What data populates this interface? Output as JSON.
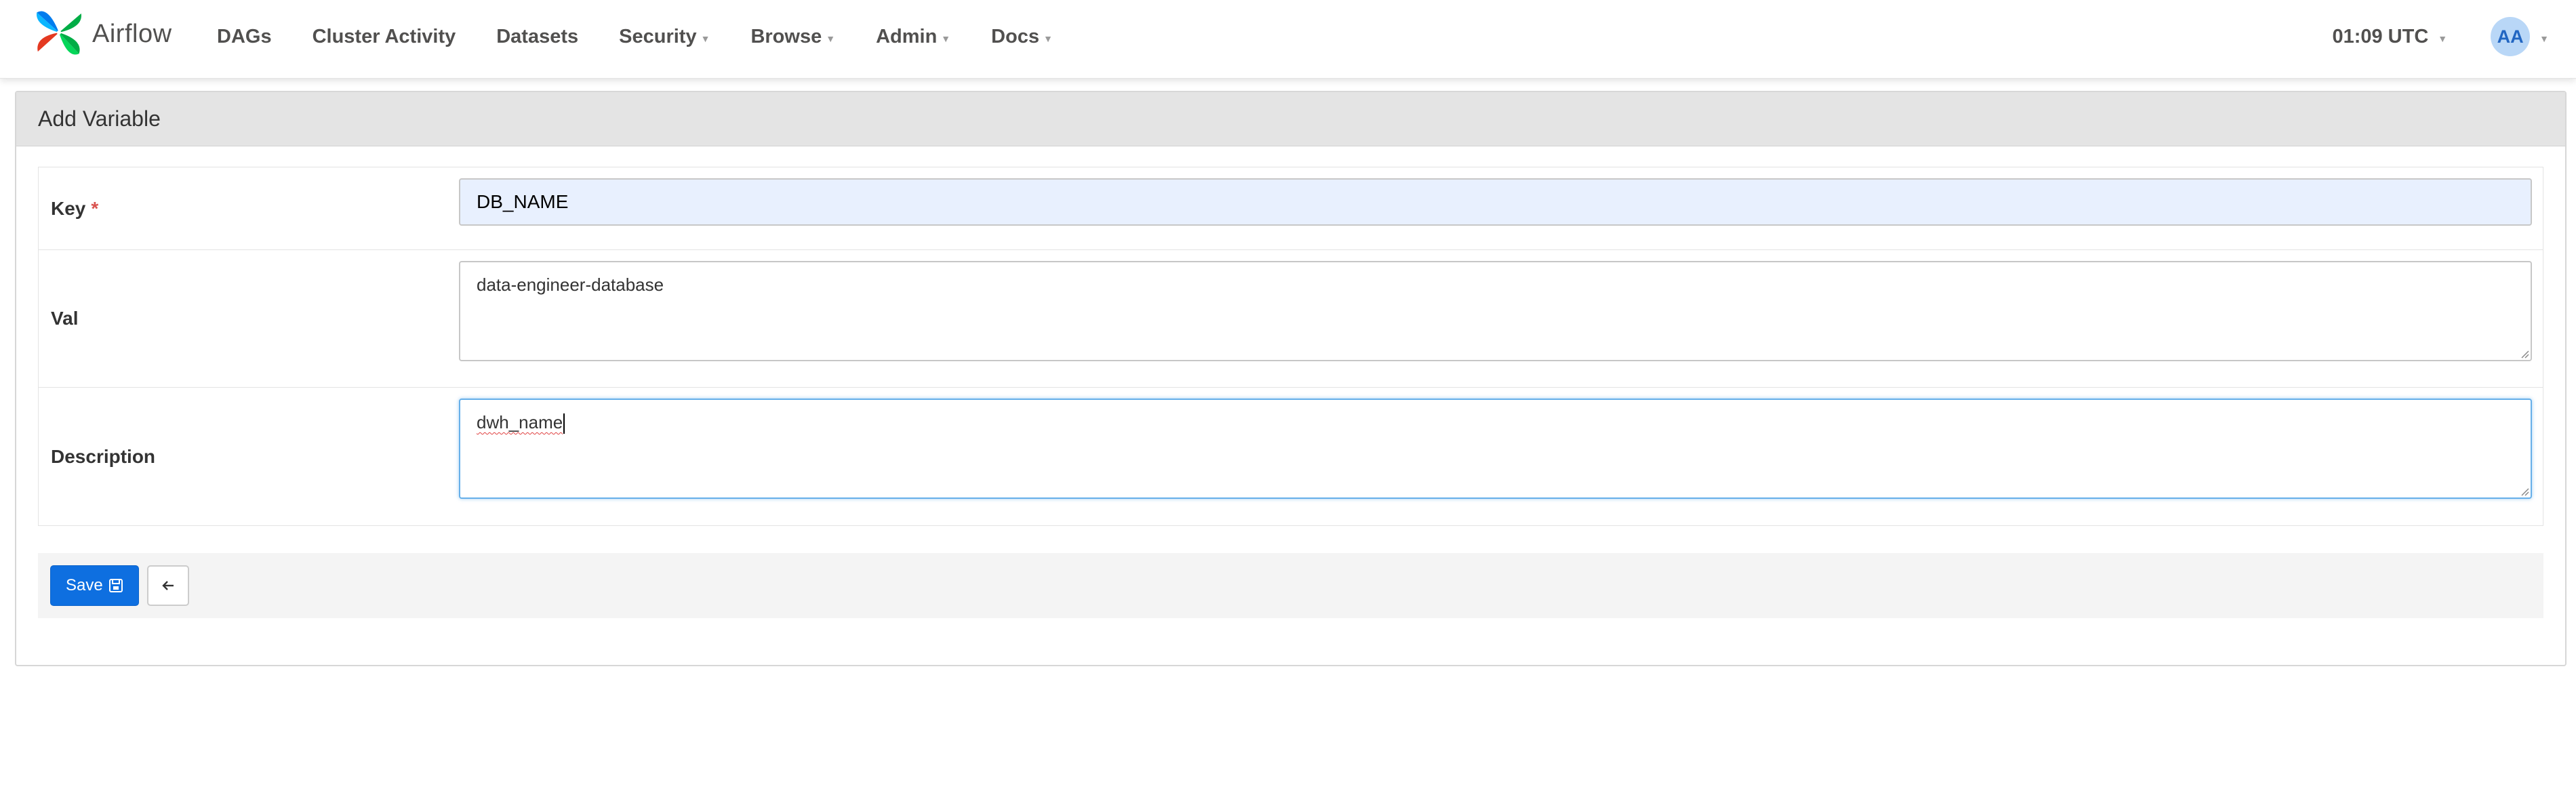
{
  "app": {
    "name": "Airflow"
  },
  "nav": {
    "items": [
      {
        "label": "DAGs",
        "dropdown": false
      },
      {
        "label": "Cluster Activity",
        "dropdown": false
      },
      {
        "label": "Datasets",
        "dropdown": false
      },
      {
        "label": "Security",
        "dropdown": true
      },
      {
        "label": "Browse",
        "dropdown": true
      },
      {
        "label": "Admin",
        "dropdown": true
      },
      {
        "label": "Docs",
        "dropdown": true
      }
    ],
    "clock": "01:09 UTC",
    "user_initials": "AA"
  },
  "form": {
    "title": "Add Variable",
    "key_label": "Key",
    "required_mark": "*",
    "key_value": "DB_NAME",
    "val_label": "Val",
    "val_value": "data-engineer-database",
    "desc_label": "Description",
    "desc_value": "dwh_name",
    "save_label": "Save"
  },
  "colors": {
    "primary": "#0e6fe0",
    "autofill_bg": "#e8f0fe",
    "required": "#d9534f",
    "avatar_bg": "#b9d7f7"
  }
}
